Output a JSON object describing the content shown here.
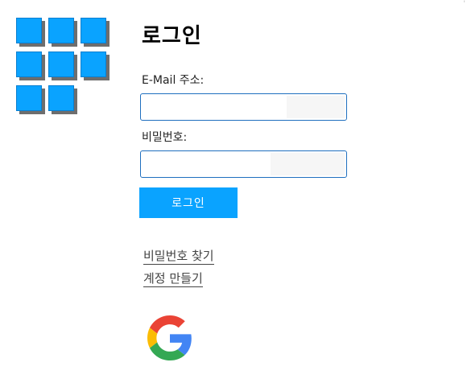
{
  "form": {
    "title": "로그인",
    "email_label": "E-Mail 주소:",
    "email_value": "",
    "password_label": "비밀번호:",
    "password_value": "",
    "login_button": "로그인"
  },
  "links": {
    "find_password": "비밀번호 찾기",
    "create_account": "계정 만들기"
  },
  "colors": {
    "accent": "#0aa3ff",
    "field_border": "#1f6fbf",
    "tile_shadow": "#6e6e6e"
  },
  "icons": {
    "logo": "grid-logo-icon",
    "google": "google-icon"
  },
  "corner_mark": "'"
}
